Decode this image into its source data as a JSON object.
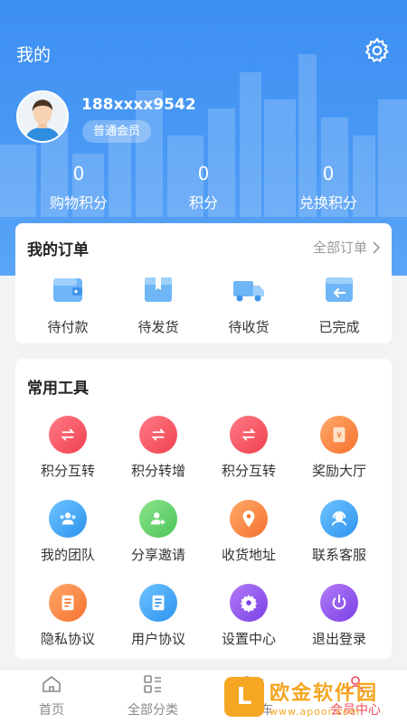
{
  "header": {
    "title": "我的",
    "phone": "188xxxx9542",
    "member_level": "普通会员",
    "settings_icon": "gear-icon",
    "bg_color": "#4a9af5"
  },
  "stats": [
    {
      "value": "0",
      "label": "购物积分"
    },
    {
      "value": "0",
      "label": "积分"
    },
    {
      "value": "0",
      "label": "兑换积分"
    }
  ],
  "orders": {
    "title": "我的订单",
    "all_label": "全部订单",
    "items": [
      {
        "label": "待付款",
        "icon": "wallet-icon"
      },
      {
        "label": "待发货",
        "icon": "box-icon"
      },
      {
        "label": "待收货",
        "icon": "truck-icon"
      },
      {
        "label": "已完成",
        "icon": "return-box-icon"
      }
    ]
  },
  "tools": {
    "title": "常用工具",
    "items": [
      {
        "label": "积分互转",
        "icon": "swap-icon",
        "color": "#f0404e"
      },
      {
        "label": "积分转增",
        "icon": "swap-icon",
        "color": "#f0404e"
      },
      {
        "label": "积分互转",
        "icon": "swap-icon",
        "color": "#f0404e"
      },
      {
        "label": "奖励大厅",
        "icon": "yen-icon",
        "color": "#f5722d"
      },
      {
        "label": "我的团队",
        "icon": "team-icon",
        "color": "#2c93ef"
      },
      {
        "label": "分享邀请",
        "icon": "add-user-icon",
        "color": "#4cc45a"
      },
      {
        "label": "收货地址",
        "icon": "location-pin-icon",
        "color": "#f5722d"
      },
      {
        "label": "联系客服",
        "icon": "headset-icon",
        "color": "#2c93ef"
      },
      {
        "label": "隐私协议",
        "icon": "document-icon",
        "color": "#f5722d"
      },
      {
        "label": "用户协议",
        "icon": "document-icon",
        "color": "#2c93ef"
      },
      {
        "label": "设置中心",
        "icon": "gear-icon",
        "color": "#7b40e6"
      },
      {
        "label": "退出登录",
        "icon": "power-icon",
        "color": "#7b40e6"
      }
    ]
  },
  "tabbar": [
    {
      "label": "首页",
      "icon": "home-icon"
    },
    {
      "label": "全部分类",
      "icon": "category-icon"
    },
    {
      "label": "购物车",
      "icon": "cart-icon"
    },
    {
      "label": "会员中心",
      "icon": "user-icon",
      "active": true
    }
  ],
  "watermark": {
    "logo": "L",
    "text": "欧金软件园",
    "url": "www.apoor.com"
  }
}
